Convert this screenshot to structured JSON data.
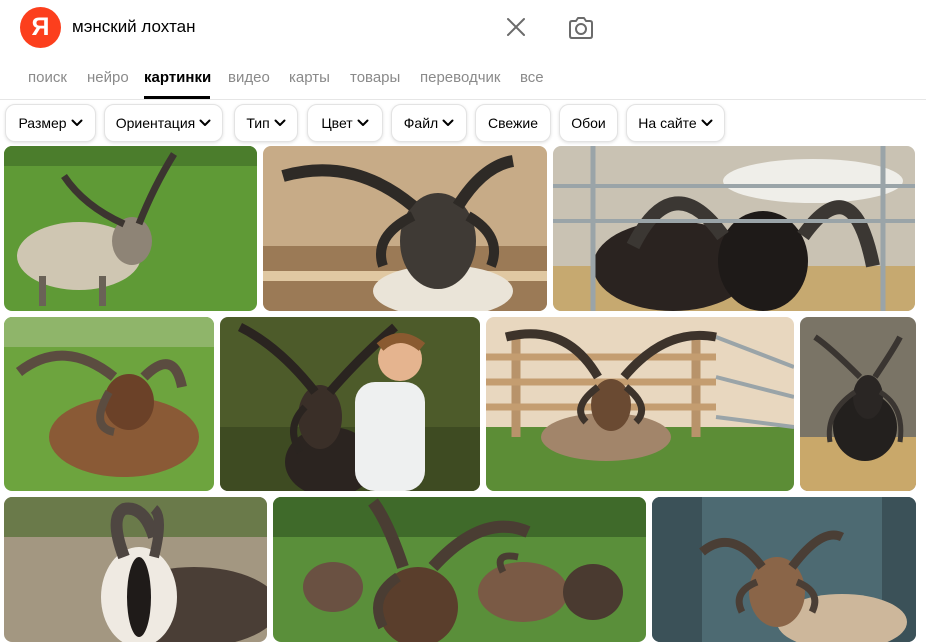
{
  "logo": {
    "letter": "Я"
  },
  "search": {
    "query": "мэнский лохтан"
  },
  "icons": {
    "clear": "close-icon",
    "camera": "camera-icon",
    "chevron": "chevron-down-icon"
  },
  "tabs": [
    {
      "label": "поиск",
      "active": false
    },
    {
      "label": "нейро",
      "active": false
    },
    {
      "label": "картинки",
      "active": true
    },
    {
      "label": "видео",
      "active": false
    },
    {
      "label": "карты",
      "active": false
    },
    {
      "label": "товары",
      "active": false
    },
    {
      "label": "переводчик",
      "active": false
    },
    {
      "label": "все",
      "active": false
    }
  ],
  "filters": [
    {
      "label": "Размер",
      "dropdown": true
    },
    {
      "label": "Ориентация",
      "dropdown": true
    },
    {
      "label": "Тип",
      "dropdown": true
    },
    {
      "label": "Цвет",
      "dropdown": true
    },
    {
      "label": "Файл",
      "dropdown": true
    },
    {
      "label": "Свежие",
      "dropdown": false
    },
    {
      "label": "Обои",
      "dropdown": false
    },
    {
      "label": "На сайте",
      "dropdown": true
    }
  ],
  "colors": {
    "brand": "#fc3f1d",
    "grass": "#5f9a36",
    "wood": "#b8936a",
    "fence": "#9aa4a8"
  }
}
